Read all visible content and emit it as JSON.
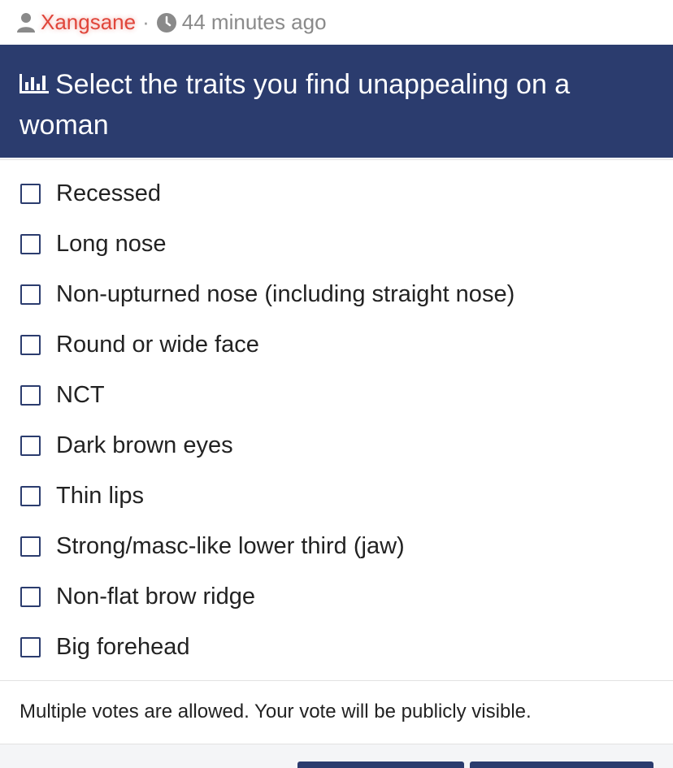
{
  "post_meta": {
    "username": "Xangsane",
    "separator": "·",
    "time_ago": "44 minutes ago"
  },
  "poll": {
    "title": "Select the traits you find unappealing on a woman",
    "options": [
      {
        "label": "Recessed",
        "checked": false
      },
      {
        "label": "Long nose",
        "checked": false
      },
      {
        "label": "Non-upturned nose (including straight nose)",
        "checked": false
      },
      {
        "label": "Round or wide face",
        "checked": false
      },
      {
        "label": "NCT",
        "checked": false
      },
      {
        "label": "Dark brown eyes",
        "checked": false
      },
      {
        "label": "Thin lips",
        "checked": false
      },
      {
        "label": "Strong/masc-like lower third (jaw)",
        "checked": false
      },
      {
        "label": "Non-flat brow ridge",
        "checked": false
      },
      {
        "label": "Big forehead",
        "checked": false
      }
    ],
    "note": "Multiple votes are allowed. Your vote will be publicly visible."
  },
  "colors": {
    "header_bg": "#2b3c6e",
    "username": "#e0453a",
    "meta_text": "#8a8a8a"
  }
}
